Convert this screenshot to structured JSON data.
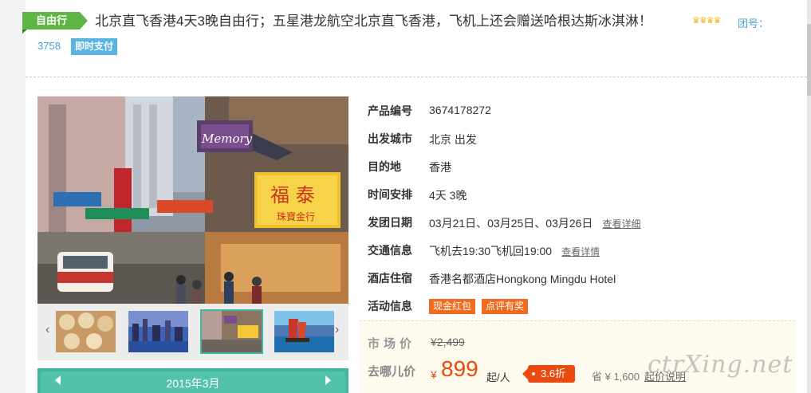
{
  "header": {
    "tag": "自由行",
    "title": "北京直飞香港4天3晚自由行；五星港龙航空北京直飞香港，飞机上还会赠送哈根达斯冰淇淋！",
    "rating_icons": "♛♛♛♛",
    "tuanhao_label": "团号：",
    "tuanhao_value": "3758",
    "pay_badge": "即时支付"
  },
  "gallery": {
    "prev_arrow": "‹",
    "next_arrow": "›",
    "thumbnails": [
      "dim-sum-thumb",
      "harbour-night-thumb",
      "street-signs-thumb",
      "junk-boat-thumb"
    ],
    "active_thumbnail": 2
  },
  "calendar": {
    "month_label": "2015年3月"
  },
  "info": {
    "product_id": {
      "label": "产品编号",
      "value": "3674178272"
    },
    "departure": {
      "label": "出发城市",
      "value": "北京 出发"
    },
    "destination": {
      "label": "目的地",
      "value": "香港"
    },
    "schedule": {
      "label": "时间安排",
      "value": "4天 3晚"
    },
    "dates": {
      "label": "发团日期",
      "value": "03月21日、03月25日、03月26日",
      "link": "查看详细"
    },
    "transport": {
      "label": "交通信息",
      "value": "飞机去19:30飞机回19:00",
      "link": "查看详情"
    },
    "hotel": {
      "label": "酒店住宿",
      "value": "香港名都酒店Hongkong Mingdu Hotel"
    },
    "activity": {
      "label": "活动信息",
      "promos": [
        "现金红包",
        "点评有奖"
      ]
    }
  },
  "price": {
    "market_label": "市场价",
    "market_value": "¥2,499",
    "qunar_label": "去哪儿价",
    "currency": "¥",
    "amount": "899",
    "unit": "起/人",
    "discount": "3.6折",
    "save_text": "省 ¥ 1,600",
    "save_link": "起价说明"
  },
  "watermark": "ctrXing.net",
  "colors": {
    "tag_green": "#5fb543",
    "link_blue": "#4aa0d6",
    "price_orange": "#e84a0f",
    "promo_orange": "#f06b1e",
    "calendar_teal": "#43b6a0"
  }
}
